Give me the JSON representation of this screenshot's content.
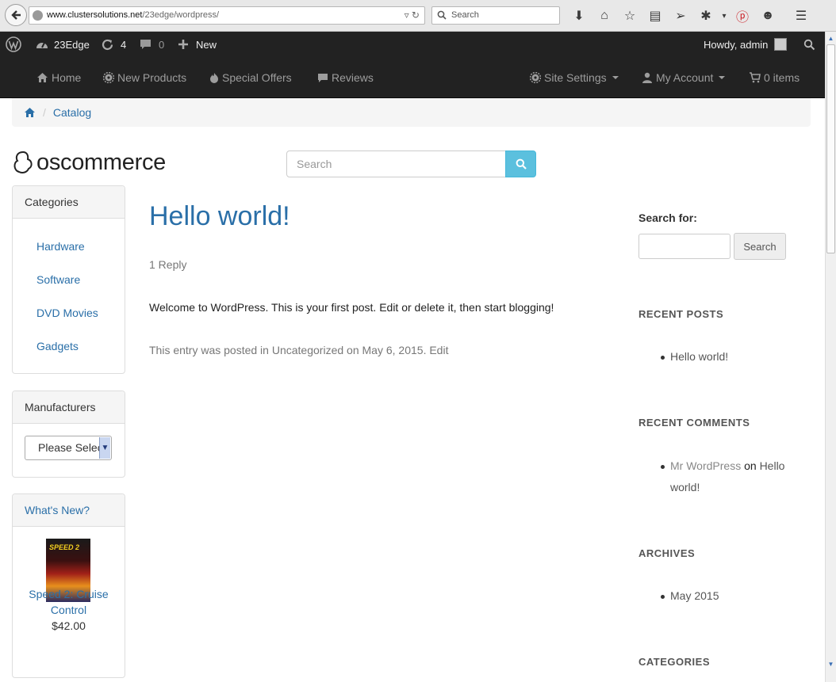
{
  "browser": {
    "url_domain": "www.clustersolutions.net",
    "url_path": "/23edge/wordpress/",
    "search_placeholder": "Search"
  },
  "admin_bar": {
    "site_name": "23Edge",
    "updates_count": "4",
    "comments_count": "0",
    "new_label": "New",
    "howdy": "Howdy, admin"
  },
  "nav": {
    "home": "Home",
    "new_products": "New Products",
    "special_offers": "Special Offers",
    "reviews": "Reviews",
    "site_settings": "Site Settings",
    "my_account": "My Account",
    "cart": "0 items"
  },
  "breadcrumb": {
    "catalog": "Catalog"
  },
  "header": {
    "logo_text": "oscommerce",
    "search_placeholder": "Search"
  },
  "categories": {
    "title": "Categories",
    "items": [
      "Hardware",
      "Software",
      "DVD Movies",
      "Gadgets"
    ]
  },
  "manufacturers": {
    "title": "Manufacturers",
    "selected": "Please Select"
  },
  "whats_new": {
    "title": "What's New?",
    "product_name": "Speed 2: Cruise Control",
    "price": "$42.00"
  },
  "post": {
    "title": "Hello world!",
    "replies": "1 Reply",
    "body": "Welcome to WordPress. This is your first post. Edit or delete it, then start blogging!",
    "meta_prefix": "This entry was posted in ",
    "meta_category": "Uncategorized",
    "meta_on": " on ",
    "meta_date": "May 6, 2015",
    "meta_dot": ". ",
    "meta_edit": "Edit"
  },
  "sidebar": {
    "search_label": "Search for:",
    "search_button": "Search",
    "recent_posts_title": "RECENT POSTS",
    "recent_post": "Hello world!",
    "recent_comments_title": "RECENT COMMENTS",
    "comment_author": "Mr WordPress",
    "comment_on": " on ",
    "comment_post": "Hello world!",
    "archives_title": "ARCHIVES",
    "archive_item": "May 2015",
    "categories_title": "CATEGORIES"
  }
}
